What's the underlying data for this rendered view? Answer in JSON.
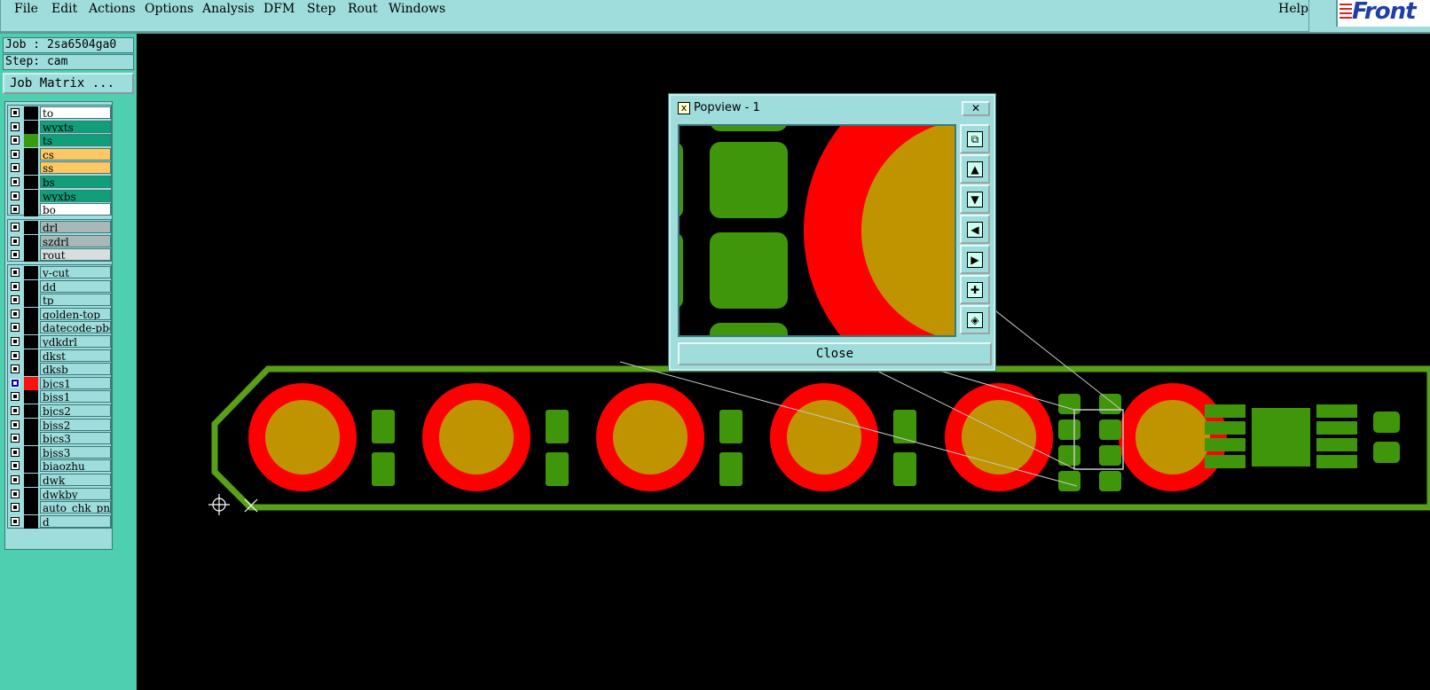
{
  "menu": {
    "items": [
      "File",
      "Edit",
      "Actions",
      "Options",
      "Analysis",
      "DFM",
      "Step",
      "Rout",
      "Windows"
    ],
    "help": "Help"
  },
  "logo": {
    "text": "Front"
  },
  "job": {
    "job_line": "Job : 2sa6504ga0",
    "step_line": "Step: cam",
    "matrix_button": "Job Matrix ..."
  },
  "layers": {
    "group1": [
      {
        "name": "to",
        "color": "#ffffff",
        "swatch": "#000000"
      },
      {
        "name": "wyxts",
        "color": "#109f78",
        "swatch": "#000000"
      },
      {
        "name": "ts",
        "color": "#109f78",
        "swatch": "#3a9a10"
      },
      {
        "name": "cs",
        "color": "#ffc862",
        "swatch": "#000000"
      },
      {
        "name": "ss",
        "color": "#ffc862",
        "swatch": "#000000"
      },
      {
        "name": "bs",
        "color": "#109f78",
        "swatch": "#000000"
      },
      {
        "name": "wyxbs",
        "color": "#109f78",
        "swatch": "#000000"
      },
      {
        "name": "bo",
        "color": "#ffffff",
        "swatch": "#000000"
      }
    ],
    "group2": [
      {
        "name": "drl",
        "color": "#a8b8b8",
        "swatch": "#000000"
      },
      {
        "name": "szdrl",
        "color": "#a8b8b8",
        "swatch": "#000000"
      },
      {
        "name": "rout",
        "color": "#d8dede",
        "swatch": "#000000"
      }
    ],
    "group3": [
      {
        "name": "v-cut",
        "color": "#9fdcdc",
        "swatch": "#000000"
      },
      {
        "name": "dd",
        "color": "#9fdcdc",
        "swatch": "#000000"
      },
      {
        "name": "tp",
        "color": "#9fdcdc",
        "swatch": "#000000"
      },
      {
        "name": "golden-top",
        "color": "#9fdcdc",
        "swatch": "#000000"
      },
      {
        "name": "datecode-pbo",
        "color": "#9fdcdc",
        "swatch": "#000000"
      },
      {
        "name": "ydkdrl",
        "color": "#9fdcdc",
        "swatch": "#000000"
      },
      {
        "name": "dkst",
        "color": "#9fdcdc",
        "swatch": "#000000"
      },
      {
        "name": "dksb",
        "color": "#9fdcdc",
        "swatch": "#000000"
      },
      {
        "name": "bjcs1",
        "color": "#9fdcdc",
        "swatch": "#ff1010",
        "selected": true
      },
      {
        "name": "bjss1",
        "color": "#9fdcdc",
        "swatch": "#000000"
      },
      {
        "name": "bjcs2",
        "color": "#9fdcdc",
        "swatch": "#000000"
      },
      {
        "name": "bjss2",
        "color": "#9fdcdc",
        "swatch": "#000000"
      },
      {
        "name": "bjcs3",
        "color": "#9fdcdc",
        "swatch": "#000000"
      },
      {
        "name": "bjss3",
        "color": "#9fdcdc",
        "swatch": "#000000"
      },
      {
        "name": "biaozhu",
        "color": "#9fdcdc",
        "swatch": "#000000"
      },
      {
        "name": "dwk",
        "color": "#9fdcdc",
        "swatch": "#000000"
      },
      {
        "name": "dwkby",
        "color": "#9fdcdc",
        "swatch": "#000000"
      },
      {
        "name": "auto_chk_pn",
        "color": "#9fdcdc",
        "swatch": "#000000"
      },
      {
        "name": "d",
        "color": "#9fdcdc",
        "swatch": "#000000"
      }
    ]
  },
  "popview": {
    "title": "Popview - 1",
    "close_label": "Close",
    "tools": [
      "zoom-window-icon",
      "pan-up-icon",
      "pan-down-icon",
      "pan-left-icon",
      "pan-right-icon",
      "zoom-in-icon",
      "zoom-out-icon"
    ]
  },
  "colors": {
    "pad_red": "#ff0000",
    "pad_gold": "#c09400",
    "copper_green": "#40960a",
    "outline_green": "#58a018",
    "panel_bg": "#9fdcdc",
    "left_bg": "#4ecfb0"
  }
}
